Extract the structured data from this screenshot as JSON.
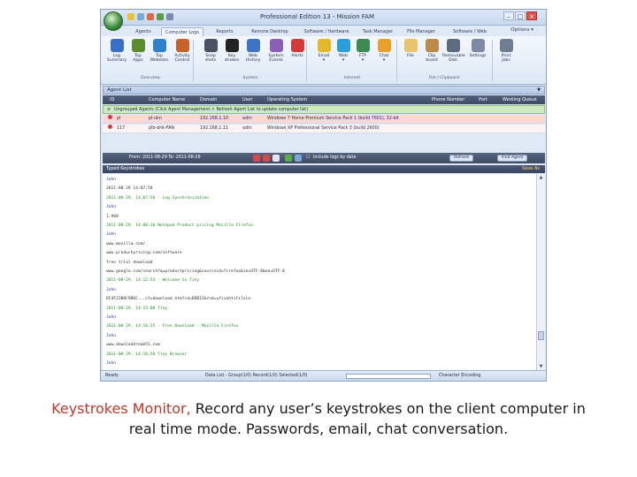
{
  "window": {
    "title": "Professional Edition 13 - Mission FAM",
    "minimize": "–",
    "maximize": "□",
    "close": "×"
  },
  "tabs": [
    "Agents",
    "Computer Logs",
    "Reports",
    "Remote Desktop",
    "Software / Hardware",
    "Task Manager",
    "File Manager",
    "Software / Web"
  ],
  "options_label": "Options ▾",
  "ribbon": {
    "buttons": [
      {
        "label": "Log\nSummary",
        "icon": "summary-icon",
        "color": "#3a6fc7"
      },
      {
        "label": "Top\nApps",
        "icon": "apps-icon",
        "color": "#5a8d2f"
      },
      {
        "label": "Top\nWebsites",
        "icon": "websites-icon",
        "color": "#2f82c9"
      },
      {
        "label": "Activity\nControl",
        "icon": "activity-icon",
        "color": "#c4622d"
      },
      {
        "label": "Snap\nshots",
        "icon": "snapshot-icon",
        "color": "#4a5160"
      },
      {
        "label": "Key\nstrokes",
        "icon": "keyboard-icon",
        "color": "#222222"
      },
      {
        "label": "Web\nHistory",
        "icon": "history-icon",
        "color": "#3e74c3"
      },
      {
        "label": "System\nEvents",
        "icon": "events-icon",
        "color": "#8a5fb8"
      },
      {
        "label": "Alerts",
        "icon": "alert-icon",
        "color": "#d33b3b"
      },
      {
        "label": "Email\n▾",
        "icon": "email-icon",
        "color": "#e2b82a"
      },
      {
        "label": "Web\n▾",
        "icon": "web-icon",
        "color": "#2a9fd8"
      },
      {
        "label": "FTP\n▾",
        "icon": "ftp-icon",
        "color": "#3d8a52"
      },
      {
        "label": "Chat\n▾",
        "icon": "chat-icon",
        "color": "#e8a02a"
      },
      {
        "label": "File",
        "icon": "file-icon",
        "color": "#e7c36a"
      },
      {
        "label": "Clip\nboard",
        "icon": "clipboard-icon",
        "color": "#b98a4a"
      },
      {
        "label": "Removable\nDisk",
        "icon": "usb-icon",
        "color": "#5c6b7d"
      },
      {
        "label": "Settings",
        "icon": "settings-icon",
        "color": "#7c8aa3"
      },
      {
        "label": "Print\nJobs",
        "icon": "print-icon",
        "color": "#6f7d92"
      }
    ],
    "groups": [
      "Overview",
      "System",
      "Internet",
      "File / Clipboard"
    ]
  },
  "agent_list": {
    "title": "Agent List",
    "columns": [
      "ID",
      "Computer Name",
      "Domain",
      "User",
      "Operating System",
      "Phone Number",
      "Port",
      "Working Queue"
    ],
    "group_row": "Ungrouped Agents (Click Agent Management > Refresh Agent List to update computer list)",
    "rows": [
      {
        "id": "pl",
        "name": "pl-ukn",
        "ip": "192.168.1.10",
        "user": "adm",
        "os": "Windows 7 Home Premium Service Pack 1 (build 7601), 32-bit"
      },
      {
        "id": "117",
        "name": "plb-dnk-FAN",
        "ip": "192.168.1.11",
        "user": "adm",
        "os": "Windows XP Professional Service Pack 3 (build 2600)"
      }
    ]
  },
  "log_toolbar": {
    "range": "From: 2011-08-29 To: 2011-08-29",
    "checkbox": "Include logs by date",
    "refresh": "Refresh",
    "find": "Find Agent"
  },
  "typed": {
    "title": "Typed Keystrokes",
    "save": "Save As"
  },
  "log_lines": [
    {
      "text": "John",
      "c": "blue"
    },
    {
      "text": "2011-08-29 14:07:50",
      "c": "dark"
    },
    {
      "text": "2011-08-29, 14:07:50 - Log Synchronization",
      "c": "green"
    },
    {
      "text": "John",
      "c": "blue"
    },
    {
      "text": "1,900",
      "c": "dark"
    },
    {
      "text": "2011-08-29, 14:08:10    Notepad    Product pricing    Mozilla Firefox",
      "c": "green"
    },
    {
      "text": "John",
      "c": "blue"
    },
    {
      "text": "www.mozilla.com/",
      "c": "dark"
    },
    {
      "text": "www.productpricing.com/software",
      "c": "dark"
    },
    {
      "text": "free trial download",
      "c": "dark"
    },
    {
      "text": "www.google.com/search?q=productpricing&sourceid=firefox&ie=UTF-8&oe=UTF-8",
      "c": "dark"
    },
    {
      "text": "2011-08-29, 14:12:54 - Welcome to Tiny",
      "c": "green"
    },
    {
      "text": "John",
      "c": "blue"
    },
    {
      "text": "DC4F23B0C9B6C...nf=download.htm?id=DDB12&rnd=ufivahtitilele",
      "c": "dark"
    },
    {
      "text": "2011-08-29, 14:13:00    Tiny",
      "c": "green"
    },
    {
      "text": "John",
      "c": "blue"
    },
    {
      "text": "2011-08-29, 14:16:25 - Free Download - Mozilla Firefox",
      "c": "green"
    },
    {
      "text": "John",
      "c": "blue"
    },
    {
      "text": "www.downloadroom51.com",
      "c": "dark"
    },
    {
      "text": "2011-08-29, 14:16:50    Tiny Browser",
      "c": "green"
    },
    {
      "text": "John",
      "c": "blue"
    }
  ],
  "status": {
    "ready": "Ready",
    "data": "Data List - Group(1/0) Record(1/0) Selected(1/0)",
    "encoding": "Character Encoding"
  },
  "caption": {
    "accent": "Keystrokes Monitor,",
    "rest_line1": " Record any user’s keystrokes on the client computer in",
    "line2": "real time mode. Passwords, email, chat conversation."
  }
}
